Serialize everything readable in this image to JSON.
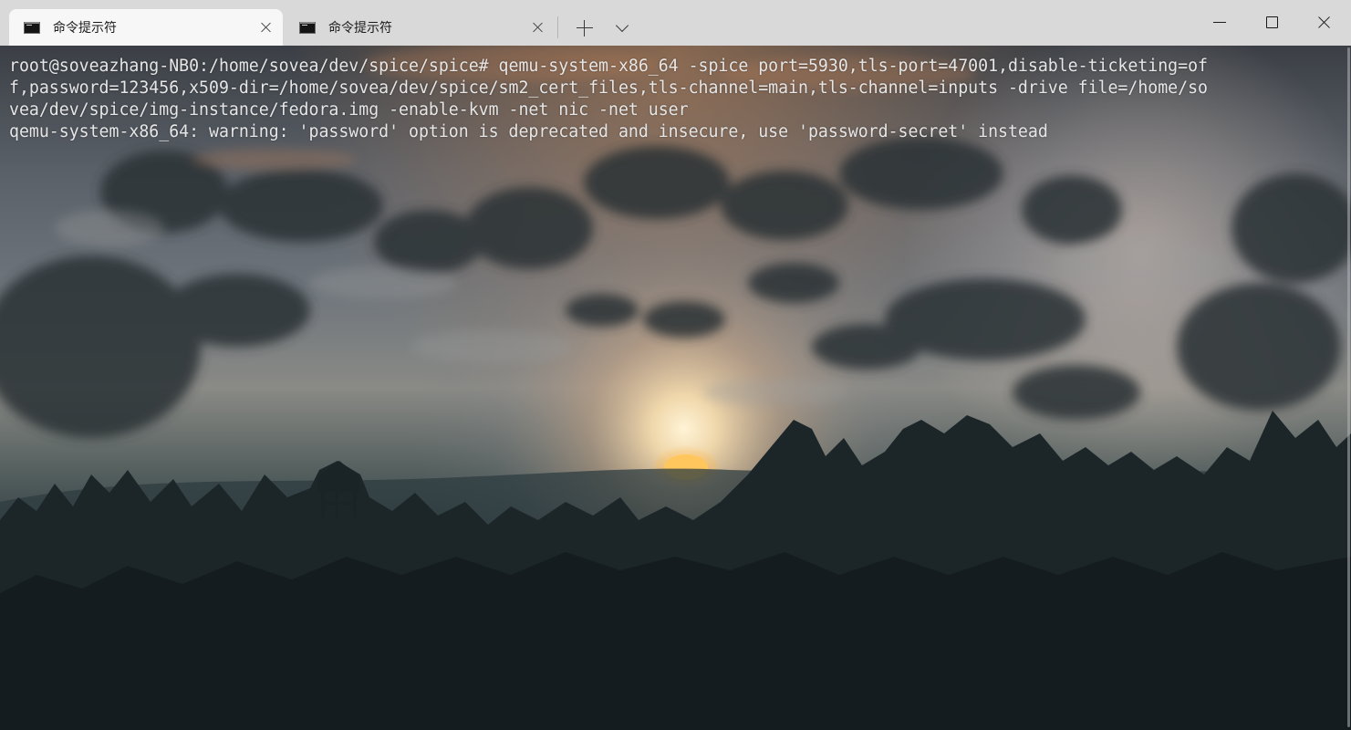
{
  "tabs": [
    {
      "title": "命令提示符",
      "active": true
    },
    {
      "title": "命令提示符",
      "active": false
    }
  ],
  "icons": {
    "tab_icon": "cmd-terminal-icon",
    "tab_close": "close-icon",
    "new_tab": "plus-icon",
    "dropdown": "chevron-down-icon",
    "minimize": "minimize-icon",
    "maximize": "maximize-icon",
    "close": "close-window-icon"
  },
  "terminal": {
    "lines": [
      "root@soveazhang-NB0:/home/sovea/dev/spice/spice# qemu-system-x86_64 -spice port=5930,tls-port=47001,disable-ticketing=of",
      "f,password=123456,x509-dir=/home/sovea/dev/spice/sm2_cert_files,tls-channel=main,tls-channel=inputs -drive file=/home/so",
      "vea/dev/spice/img-instance/fedora.img -enable-kvm -net nic -net user",
      "qemu-system-x86_64: warning: 'password' option is deprecated and insecure, use 'password-secret' instead"
    ],
    "text_color": "#e6e6e6",
    "background_image": "sunset sky over forest silhouette"
  }
}
